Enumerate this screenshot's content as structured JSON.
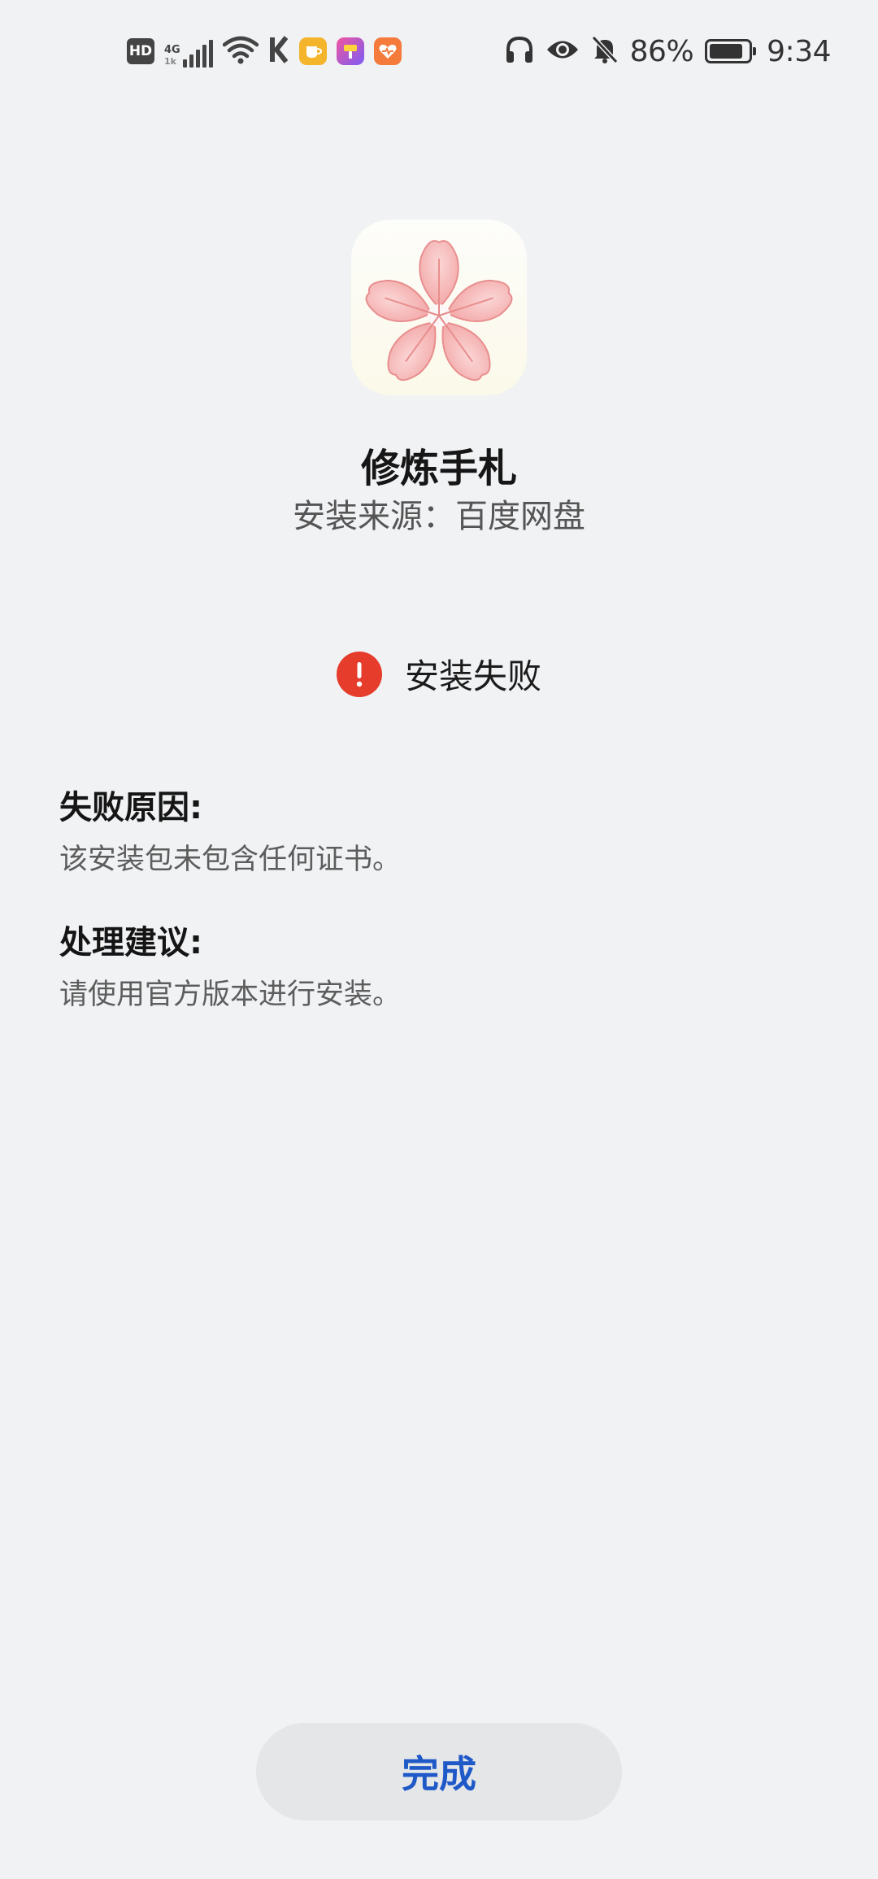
{
  "status_bar": {
    "hd_label": "HD",
    "network_label": "4G",
    "network_sub_label": "1k",
    "battery_percent": 86,
    "battery_text": "86%",
    "time": "9:34",
    "icons": [
      "hd-icon",
      "signal-icon",
      "wifi-icon",
      "k-app-icon",
      "cup-app-icon",
      "paint-app-icon",
      "heart-app-icon",
      "headphones-icon",
      "eye-icon",
      "bell-off-icon",
      "battery-icon"
    ]
  },
  "app": {
    "name": "修炼手札",
    "source_line": "安装来源：百度网盘",
    "icon": "cherry-blossom-icon"
  },
  "status": {
    "icon": "error-icon",
    "text": "安装失败",
    "color": "#e53c2b"
  },
  "failure": {
    "title": "失败原因:",
    "body": "该安装包未包含任何证书。"
  },
  "suggestion": {
    "title": "处理建议:",
    "body": "请使用官方版本进行安装。"
  },
  "done_button": {
    "label": "完成",
    "color": "#1f59c8"
  }
}
